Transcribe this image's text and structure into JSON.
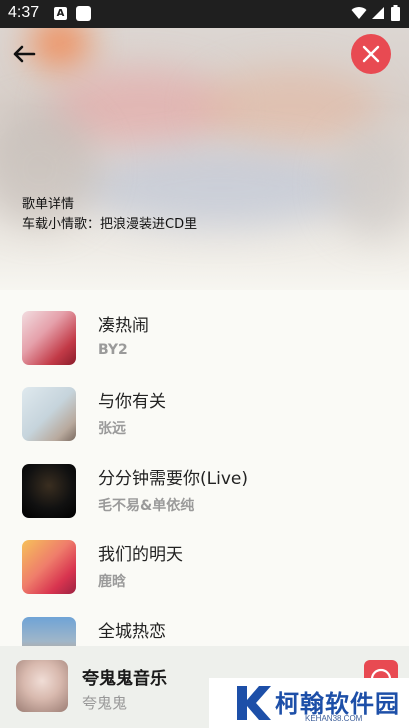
{
  "status_bar": {
    "time": "4:37"
  },
  "header": {
    "title": "歌单详情",
    "subtitle": "车载小情歌：把浪漫装进CD里"
  },
  "songs": [
    {
      "title": "凑热闹",
      "artist": "BY2"
    },
    {
      "title": "与你有关",
      "artist": "张远"
    },
    {
      "title": "分分钟需要你(Live)",
      "artist": "毛不易&单依纯"
    },
    {
      "title": "我们的明天",
      "artist": "鹿晗"
    },
    {
      "title": "全城热恋",
      "artist": ""
    }
  ],
  "player": {
    "title": "夸鬼鬼音乐",
    "author": "夸鬼鬼"
  },
  "watermark": {
    "text": "柯翰软件园",
    "url": "KEHAN38.COM"
  },
  "colors": {
    "accent": "#e84a52",
    "status_bar": "#1f1f1f",
    "watermark_blue": "#1d4fa8"
  },
  "icons": [
    "back-arrow-icon",
    "close-icon",
    "play-icon",
    "wifi-icon",
    "signal-icon",
    "battery-icon"
  ]
}
